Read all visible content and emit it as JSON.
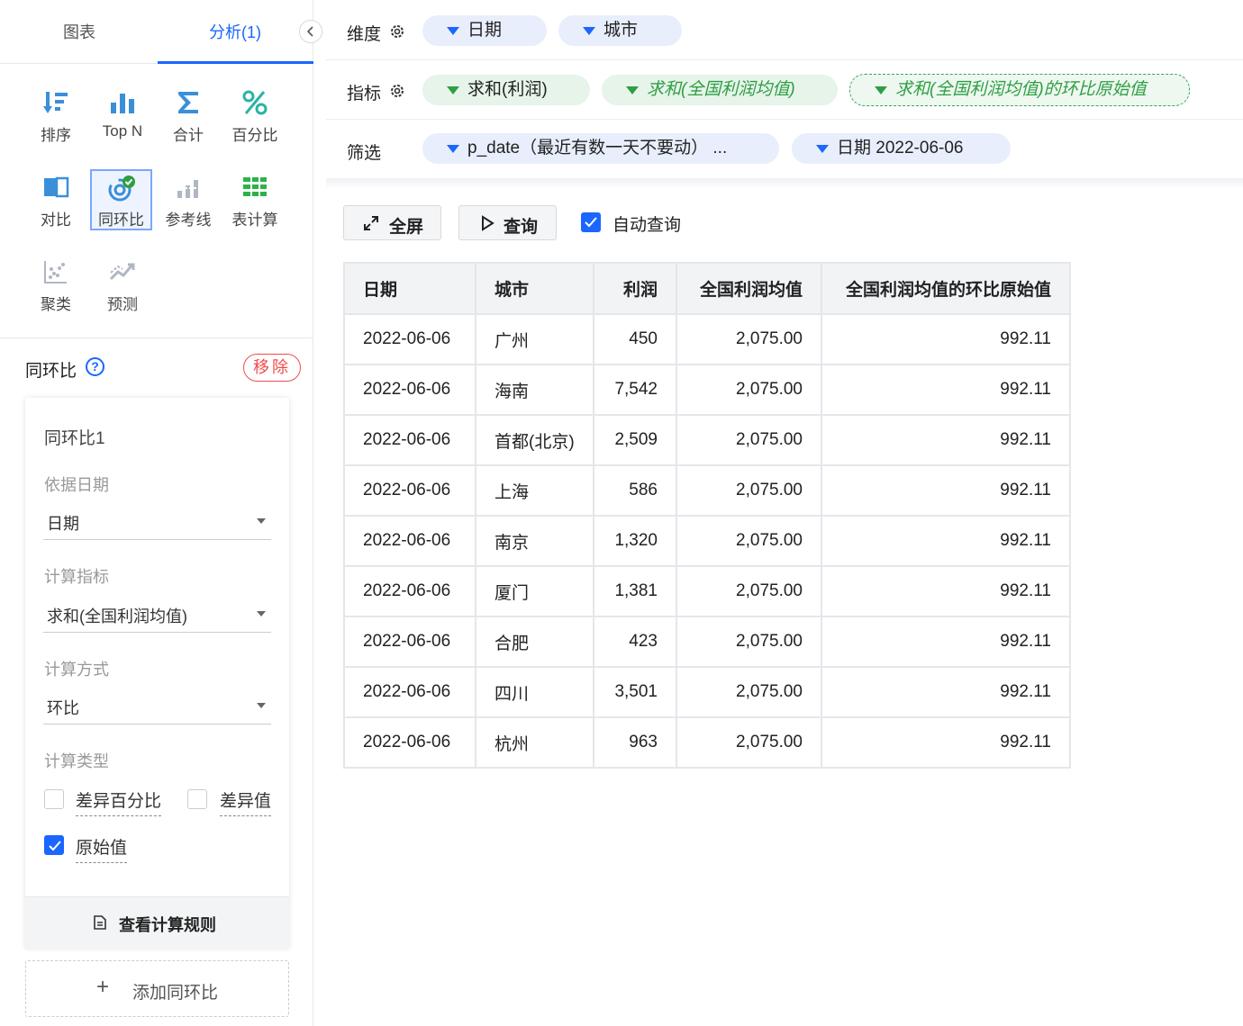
{
  "left_panel": {
    "tabs": [
      {
        "label": "图表"
      },
      {
        "label": "分析(1)"
      }
    ],
    "tools": [
      {
        "label": "排序",
        "icon": "sort-icon"
      },
      {
        "label": "Top N",
        "icon": "bar-chart-icon"
      },
      {
        "label": "合计",
        "icon": "sigma-icon"
      },
      {
        "label": "百分比",
        "icon": "percent-icon"
      },
      {
        "label": "对比",
        "icon": "compare-icon"
      },
      {
        "label": "同环比",
        "icon": "yoy-icon"
      },
      {
        "label": "参考线",
        "icon": "reference-line-icon"
      },
      {
        "label": "表计算",
        "icon": "table-calc-icon"
      },
      {
        "label": "聚类",
        "icon": "cluster-icon"
      },
      {
        "label": "预测",
        "icon": "forecast-icon"
      }
    ],
    "section": {
      "title": "同环比",
      "help": "?",
      "remove_label": "移除"
    },
    "card": {
      "title": "同环比1",
      "date_label": "依据日期",
      "date_value": "日期",
      "metric_label": "计算指标",
      "metric_value": "求和(全国利润均值)",
      "method_label": "计算方式",
      "method_value": "环比",
      "type_label": "计算类型",
      "types": [
        {
          "label": "差异百分比",
          "checked": false
        },
        {
          "label": "差异值",
          "checked": false
        },
        {
          "label": "原始值",
          "checked": true
        }
      ],
      "footer_label": "查看计算规则"
    },
    "add_label": "添加同环比",
    "add_icon": "+"
  },
  "toolbar_rows": {
    "dimension": {
      "label": "维度",
      "pills": [
        "日期",
        "城市"
      ]
    },
    "metric": {
      "label": "指标",
      "pills": [
        "求和(利润)",
        "求和(全国利润均值)",
        "求和(全国利润均值)的环比原始值"
      ]
    },
    "filter": {
      "label": "筛选",
      "pills": [
        "p_date（最近有数一天不要动） ...",
        "日期 2022-06-06"
      ]
    }
  },
  "actions": {
    "fullscreen": "全屏",
    "query": "查询",
    "auto_query": "自动查询",
    "auto_query_checked": true
  },
  "table": {
    "headers": [
      "日期",
      "城市",
      "利润",
      "全国利润均值",
      "全国利润均值的环比原始值"
    ],
    "rows": [
      [
        "2022-06-06",
        "广州",
        "450",
        "2,075.00",
        "992.11"
      ],
      [
        "2022-06-06",
        "海南",
        "7,542",
        "2,075.00",
        "992.11"
      ],
      [
        "2022-06-06",
        "首都(北京)",
        "2,509",
        "2,075.00",
        "992.11"
      ],
      [
        "2022-06-06",
        "上海",
        "586",
        "2,075.00",
        "992.11"
      ],
      [
        "2022-06-06",
        "南京",
        "1,320",
        "2,075.00",
        "992.11"
      ],
      [
        "2022-06-06",
        "厦门",
        "1,381",
        "2,075.00",
        "992.11"
      ],
      [
        "2022-06-06",
        "合肥",
        "423",
        "2,075.00",
        "992.11"
      ],
      [
        "2022-06-06",
        "四川",
        "3,501",
        "2,075.00",
        "992.11"
      ],
      [
        "2022-06-06",
        "杭州",
        "963",
        "2,075.00",
        "992.11"
      ]
    ]
  },
  "colors": {
    "accent": "#1a66ff",
    "danger": "#f24b4b",
    "green": "#2f9e44"
  }
}
